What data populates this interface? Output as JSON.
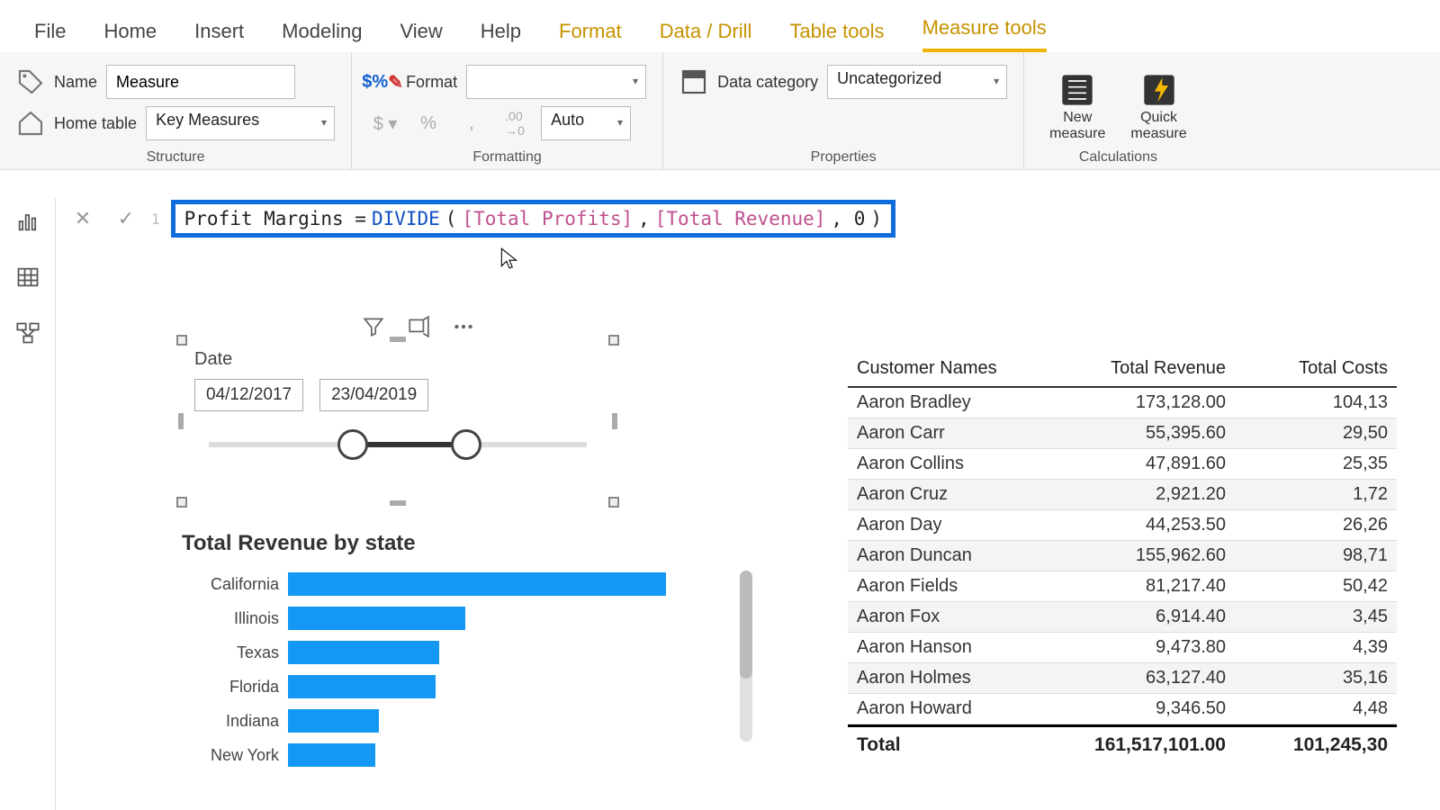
{
  "tabs": {
    "file": "File",
    "home": "Home",
    "insert": "Insert",
    "modeling": "Modeling",
    "view": "View",
    "help": "Help",
    "format": "Format",
    "datadrill": "Data / Drill",
    "tabletools": "Table tools",
    "measuretools": "Measure tools"
  },
  "ribbon": {
    "structure": {
      "group_label": "Structure",
      "name_label": "Name",
      "name_value": "Measure",
      "home_table_label": "Home table",
      "home_table_value": "Key Measures"
    },
    "formatting": {
      "group_label": "Formatting",
      "format_label": "Format",
      "format_value": "",
      "decimals_value": "Auto"
    },
    "properties": {
      "group_label": "Properties",
      "category_label": "Data category",
      "category_value": "Uncategorized"
    },
    "calc": {
      "group_label": "Calculations",
      "new_measure": "New\nmeasure",
      "quick_measure": "Quick\nmeasure"
    }
  },
  "formula": {
    "line": "1",
    "prefix": "Profit Margins = ",
    "func": "DIVIDE",
    "open": "( ",
    "m1": "[Total Profits]",
    "sep1": ", ",
    "m2": "[Total Revenue]",
    "sep2": ", 0 ",
    "close": ")"
  },
  "slicer": {
    "title": "Date",
    "start": "04/12/2017",
    "end": "23/04/2019"
  },
  "chart_data": {
    "type": "bar",
    "title": "Total Revenue by state",
    "categories": [
      "California",
      "Illinois",
      "Texas",
      "Florida",
      "Indiana",
      "New York"
    ],
    "values": [
      100,
      47,
      40,
      39,
      24,
      23
    ],
    "xlabel": "",
    "ylabel": "",
    "ylim": [
      0,
      100
    ]
  },
  "table": {
    "headers": [
      "Customer Names",
      "Total Revenue",
      "Total Costs"
    ],
    "rows": [
      {
        "name": "Aaron Bradley",
        "rev": "173,128.00",
        "cost": "104,13"
      },
      {
        "name": "Aaron Carr",
        "rev": "55,395.60",
        "cost": "29,50"
      },
      {
        "name": "Aaron Collins",
        "rev": "47,891.60",
        "cost": "25,35"
      },
      {
        "name": "Aaron Cruz",
        "rev": "2,921.20",
        "cost": "1,72"
      },
      {
        "name": "Aaron Day",
        "rev": "44,253.50",
        "cost": "26,26"
      },
      {
        "name": "Aaron Duncan",
        "rev": "155,962.60",
        "cost": "98,71"
      },
      {
        "name": "Aaron Fields",
        "rev": "81,217.40",
        "cost": "50,42"
      },
      {
        "name": "Aaron Fox",
        "rev": "6,914.40",
        "cost": "3,45"
      },
      {
        "name": "Aaron Hanson",
        "rev": "9,473.80",
        "cost": "4,39"
      },
      {
        "name": "Aaron Holmes",
        "rev": "63,127.40",
        "cost": "35,16"
      },
      {
        "name": "Aaron Howard",
        "rev": "9,346.50",
        "cost": "4,48"
      }
    ],
    "total": {
      "label": "Total",
      "rev": "161,517,101.00",
      "cost": "101,245,30"
    }
  }
}
